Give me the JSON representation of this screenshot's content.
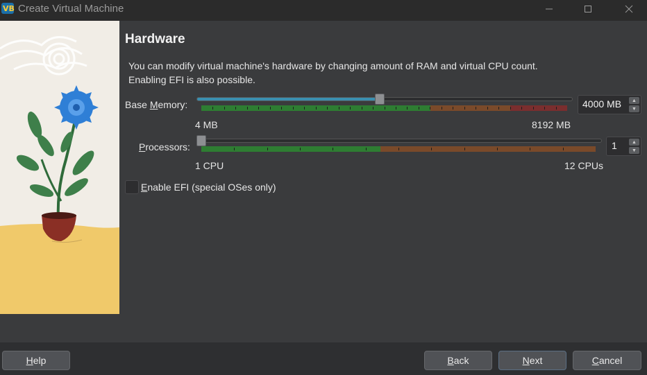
{
  "window": {
    "title": "Create Virtual Machine"
  },
  "page": {
    "heading": "Hardware",
    "description_line1": "You can modify virtual machine's hardware by changing amount of RAM and virtual CPU count.",
    "description_line2": "Enabling EFI is also possible."
  },
  "memory": {
    "label_prefix": "Base ",
    "label_mnemonic": "M",
    "label_suffix": "emory:",
    "min_label": "4 MB",
    "max_label": "8192 MB",
    "value": "4000 MB",
    "value_fraction": 0.488
  },
  "processors": {
    "label_mnemonic": "P",
    "label_suffix": "rocessors:",
    "min_label": "1 CPU",
    "max_label": "12 CPUs",
    "value": "1",
    "value_fraction": 0.0
  },
  "efi": {
    "label_mnemonic": "E",
    "label_suffix": "nable EFI (special OSes only)",
    "checked": false
  },
  "buttons": {
    "help_mnemonic": "H",
    "help_rest": "elp",
    "back_mnemonic": "B",
    "back_rest": "ack",
    "next_mnemonic": "N",
    "next_rest": "ext",
    "cancel_mnemonic": "C",
    "cancel_rest": "ancel"
  },
  "colors": {
    "safe": "#2e7d32",
    "warning": "#7a4a2a",
    "danger": "#7a2e2e",
    "slider_fill": "#3a8fb0"
  }
}
